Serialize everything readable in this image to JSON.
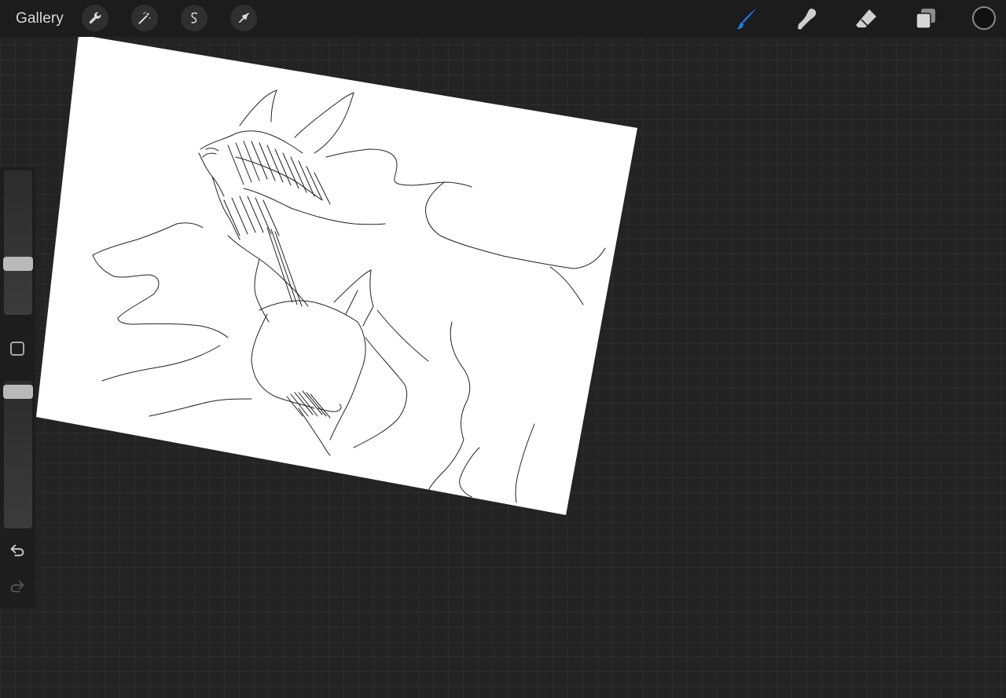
{
  "toolbar": {
    "gallery_label": "Gallery",
    "left_tools": [
      {
        "name": "actions",
        "icon": "wrench-icon"
      },
      {
        "name": "adjustments",
        "icon": "magic-wand-icon"
      },
      {
        "name": "selection",
        "icon": "selection-s-icon"
      },
      {
        "name": "transform",
        "icon": "arrow-cursor-icon"
      }
    ],
    "right_tools": [
      {
        "name": "brush",
        "icon": "brush-icon",
        "active": true
      },
      {
        "name": "smudge",
        "icon": "smudge-finger-icon",
        "active": false
      },
      {
        "name": "eraser",
        "icon": "eraser-icon",
        "active": false
      },
      {
        "name": "layers",
        "icon": "layers-icon",
        "active": false
      }
    ],
    "current_color": "#111111"
  },
  "sidebar": {
    "brush_size_level": 0.6,
    "opacity_level": 0.95,
    "modify_icon": "square-modify-icon",
    "undo_icon": "undo-arrow-icon",
    "redo_icon": "redo-arrow-icon"
  },
  "colors": {
    "background": "#232323",
    "toolbar": "#1c1c1c",
    "accent_brush": "#1f7cf2",
    "paper": "#ffffff"
  }
}
